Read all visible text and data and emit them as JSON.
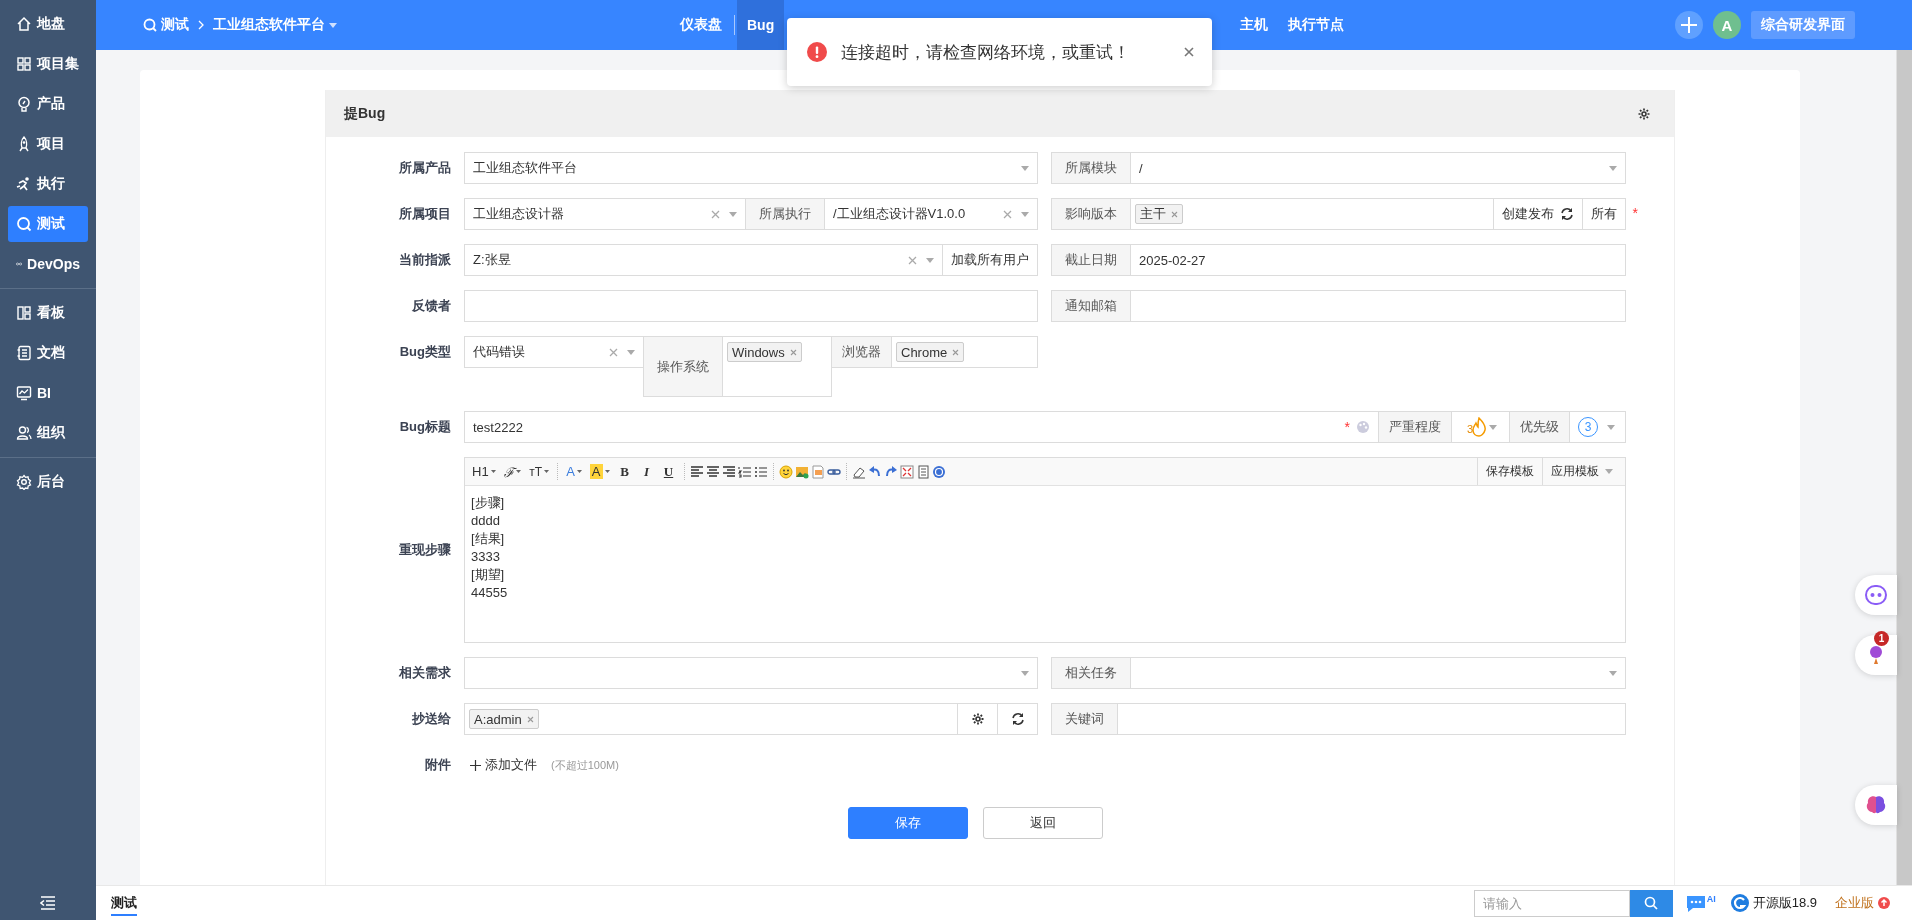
{
  "sidebar": {
    "sections": [
      {
        "items": [
          {
            "label": "地盘",
            "selected": false
          },
          {
            "label": "项目集",
            "selected": false
          },
          {
            "label": "产品",
            "selected": false
          },
          {
            "label": "项目",
            "selected": false
          },
          {
            "label": "执行",
            "selected": false
          },
          {
            "label": "测试",
            "selected": true
          },
          {
            "label": "DevOps",
            "selected": false
          }
        ]
      },
      {
        "items": [
          {
            "label": "看板",
            "selected": false
          },
          {
            "label": "文档",
            "selected": false
          },
          {
            "label": "BI",
            "selected": false
          },
          {
            "label": "组织",
            "selected": false
          }
        ]
      },
      {
        "items": [
          {
            "label": "后台",
            "selected": false
          }
        ]
      }
    ]
  },
  "topbar": {
    "breadcrumb": [
      {
        "label": "测试"
      },
      {
        "label": "工业组态软件平台"
      }
    ],
    "nav": [
      {
        "label": "仪表盘",
        "selected": false
      },
      {
        "label": "Bug",
        "selected": true
      },
      {
        "label": "主机",
        "selected": false
      },
      {
        "label": "执行节点",
        "selected": false
      }
    ],
    "avatar": "A",
    "switch_button": "综合研发界面"
  },
  "toast": {
    "message": "连接超时，请检查网络环境，或重试！"
  },
  "form": {
    "title": "提Bug",
    "required_mark": "*",
    "product": {
      "label": "所属产品",
      "value": "工业组态软件平台"
    },
    "module": {
      "label": "所属模块",
      "value": "/"
    },
    "project": {
      "label": "所属项目",
      "value": "工业组态设计器"
    },
    "execution": {
      "label": "所属执行",
      "value": "/工业组态设计器V1.0.0"
    },
    "build": {
      "label": "影响版本",
      "tags": [
        "主干"
      ],
      "create_button": "创建发布",
      "all_button": "所有",
      "required": true
    },
    "assigned": {
      "label": "当前指派",
      "value": "Z:张昱",
      "button": "加载所有用户"
    },
    "deadline": {
      "label": "截止日期",
      "value": "2025-02-27"
    },
    "reporter": {
      "label": "反馈者"
    },
    "notify": {
      "label": "通知邮箱"
    },
    "type": {
      "label": "Bug类型",
      "value": "代码错误"
    },
    "os": {
      "label": "操作系统",
      "tags": [
        "Windows"
      ]
    },
    "browser": {
      "label": "浏览器",
      "tags": [
        "Chrome"
      ]
    },
    "title_field": {
      "label": "Bug标题",
      "value": "test2222",
      "required": true
    },
    "severity": {
      "label": "严重程度",
      "value": "3"
    },
    "priority": {
      "label": "优先级",
      "value": "3"
    },
    "steps": {
      "label": "重现步骤",
      "toolbar": {
        "heading": "H1",
        "font_family": "ℱ",
        "font_size": "тT",
        "font_color": "A",
        "bg_color": "A",
        "bold": "B",
        "italic": "I",
        "underline": "U",
        "save_template": "保存模板",
        "apply_template": "应用模板"
      },
      "lines": [
        "[步骤]",
        "dddd",
        "[结果]",
        "3333",
        "[期望]",
        "44555"
      ]
    },
    "story": {
      "label": "相关需求"
    },
    "task": {
      "label": "相关任务"
    },
    "mailto": {
      "label": "抄送给",
      "tags": [
        "A:admin"
      ]
    },
    "keywords": {
      "label": "关键词"
    },
    "files": {
      "label": "附件",
      "add_button": "添加文件",
      "hint": "(不超过100M)"
    },
    "save_button": "保存",
    "back_button": "返回"
  },
  "side_widgets": {
    "badge": "1"
  },
  "footer": {
    "tab": "测试",
    "search_placeholder": "请输入",
    "ai_label": "AI",
    "version": "开源版18.9",
    "edition": "企业版"
  }
}
